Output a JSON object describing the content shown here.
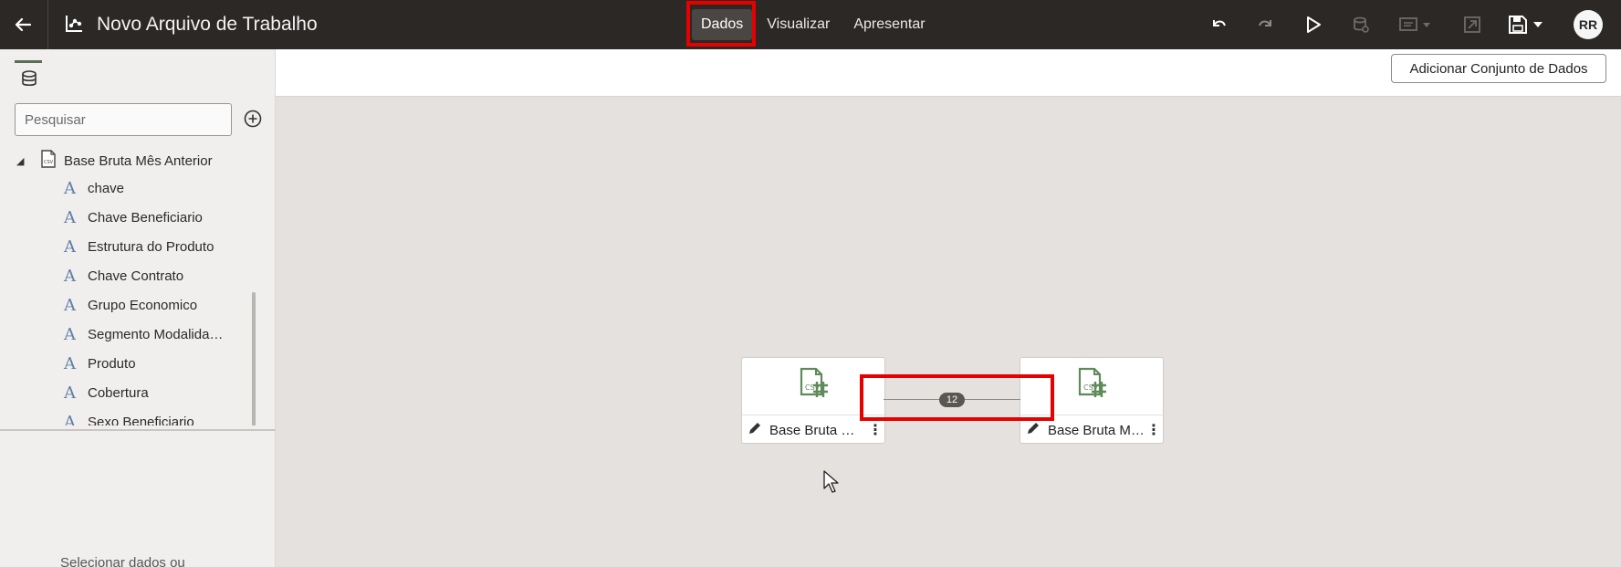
{
  "header": {
    "title": "Novo Arquivo de Trabalho",
    "tabs": [
      {
        "label": "Dados",
        "active": true
      },
      {
        "label": "Visualizar",
        "active": false
      },
      {
        "label": "Apresentar",
        "active": false
      }
    ],
    "user_initials": "RR",
    "icons": [
      "back-arrow-icon",
      "workbook-icon",
      "undo-icon",
      "redo-icon",
      "play-icon",
      "data-refresh-icon",
      "comment-icon",
      "export-icon",
      "save-icon"
    ]
  },
  "left_panel": {
    "search_placeholder": "Pesquisar",
    "dataset": {
      "name": "Base Bruta Mês Anterior",
      "columns": [
        "chave",
        "Chave Beneficiario",
        "Estrutura do Produto",
        "Chave Contrato",
        "Grupo Economico",
        "Segmento Modalida…",
        "Produto",
        "Cobertura",
        "Sexo Beneficiario"
      ],
      "column_type_glyph": "A"
    },
    "hint_text": "Selecionar dados ou"
  },
  "content": {
    "add_dataset_label": "Adicionar Conjunto de Dados",
    "nodes": [
      {
        "label": "Base Bruta …"
      },
      {
        "label": "Base Bruta Mê…"
      }
    ],
    "join_count": "12"
  },
  "colors": {
    "header_bg": "#2b2826",
    "highlight": "#e60000",
    "canvas_bg": "#e4e1de",
    "icon_green": "#5f8a5a"
  }
}
